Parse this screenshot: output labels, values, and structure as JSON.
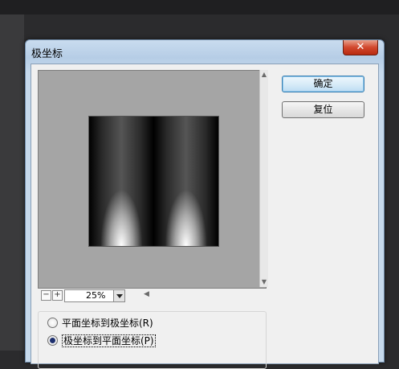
{
  "dialog": {
    "title": "极坐标",
    "close_glyph": "✕"
  },
  "buttons": {
    "ok": "确定",
    "reset": "复位"
  },
  "zoom": {
    "minus": "−",
    "plus": "+",
    "value": "25%"
  },
  "options": {
    "rect_to_polar": "平面坐标到极坐标(R)",
    "polar_to_rect": "极坐标到平面坐标(P)",
    "selected": "polar_to_rect"
  },
  "icons": {
    "scroll_up": "▲",
    "scroll_down": "▼",
    "scroll_left": "◀"
  }
}
